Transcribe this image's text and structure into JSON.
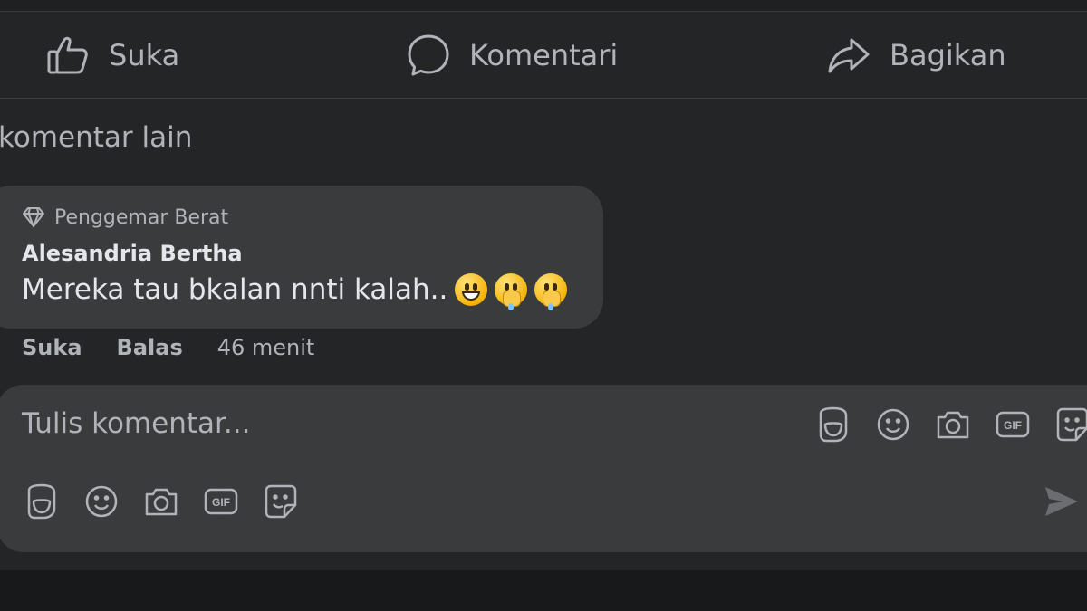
{
  "actions": {
    "like_label": "Suka",
    "comment_label": "Komentari",
    "share_label": "Bagikan"
  },
  "comments": {
    "more_label": "komentar lain",
    "items": [
      {
        "badge": "Penggemar Berat",
        "author": "Alesandria Bertha",
        "text": "Mereka tau bkalan nnti kalah..",
        "like_label": "Suka",
        "reply_label": "Balas",
        "time": "46 menit"
      }
    ]
  },
  "composer": {
    "placeholder": "Tulis komentar...",
    "icons": [
      "avatar-sticker-icon",
      "emoji-icon",
      "camera-icon",
      "gif-icon",
      "sticker-icon"
    ],
    "send_icon": "send-icon"
  },
  "colors": {
    "background": "#242526",
    "bubble": "#3a3b3c",
    "text_primary": "#e4e6eb",
    "text_secondary": "#b0b3b8"
  }
}
